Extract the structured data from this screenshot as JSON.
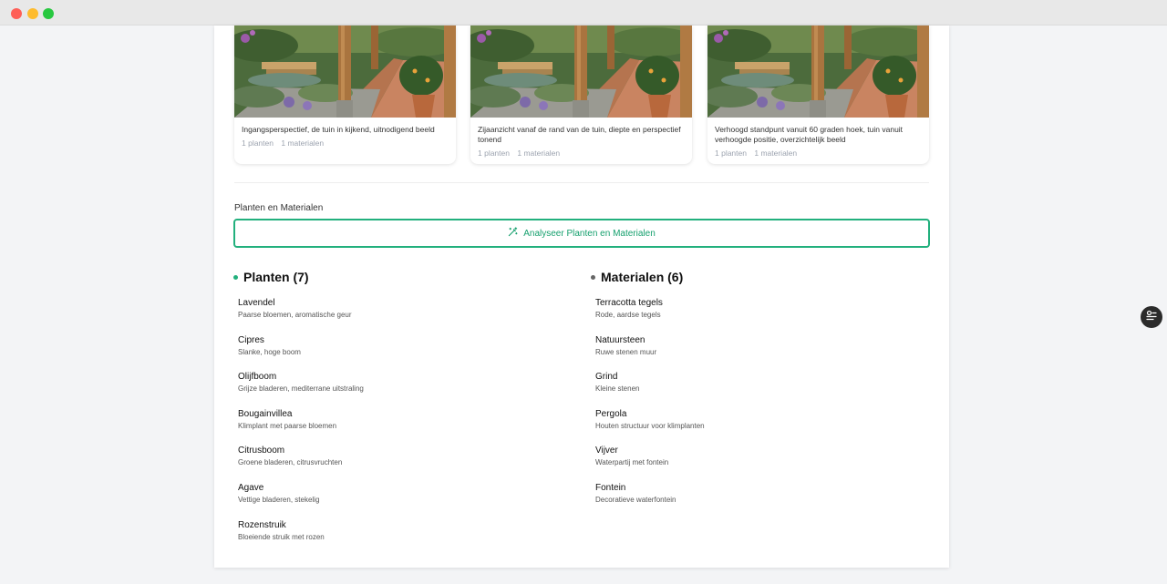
{
  "window": {
    "controls": [
      "close",
      "minimize",
      "maximize"
    ]
  },
  "cards": [
    {
      "title": "Ingangsperspectief, de tuin in kijkend, uitnodigend beeld",
      "plants": "1 planten",
      "materials": "1 materialen"
    },
    {
      "title": "Zijaanzicht vanaf de rand van de tuin, diepte en perspectief tonend",
      "plants": "1 planten",
      "materials": "1 materialen"
    },
    {
      "title": "Verhoogd standpunt vanuit 60 graden hoek, tuin vanuit verhoogde positie, overzichtelijk beeld",
      "plants": "1 planten",
      "materials": "1 materialen"
    }
  ],
  "section": {
    "label": "Planten en Materialen",
    "analyze_button": "Analyseer Planten en Materialen",
    "analyze_icon": "magic-wand-icon"
  },
  "plants": {
    "title": "Planten (7)",
    "items": [
      {
        "name": "Lavendel",
        "desc": "Paarse bloemen, aromatische geur"
      },
      {
        "name": "Cipres",
        "desc": "Slanke, hoge boom"
      },
      {
        "name": "Olijfboom",
        "desc": "Grijze bladeren, mediterrane uitstraling"
      },
      {
        "name": "Bougainvillea",
        "desc": "Klimplant met paarse bloemen"
      },
      {
        "name": "Citrusboom",
        "desc": "Groene bladeren, citrusvruchten"
      },
      {
        "name": "Agave",
        "desc": "Vettige bladeren, stekelig"
      },
      {
        "name": "Rozenstruik",
        "desc": "Bloeiende struik met rozen"
      }
    ]
  },
  "materials": {
    "title": "Materialen (6)",
    "items": [
      {
        "name": "Terracotta tegels",
        "desc": "Rode, aardse tegels"
      },
      {
        "name": "Natuursteen",
        "desc": "Ruwe stenen muur"
      },
      {
        "name": "Grind",
        "desc": "Kleine stenen"
      },
      {
        "name": "Pergola",
        "desc": "Houten structuur voor klimplanten"
      },
      {
        "name": "Vijver",
        "desc": "Waterpartij met fontein"
      },
      {
        "name": "Fontein",
        "desc": "Decoratieve waterfontein"
      }
    ]
  },
  "floating_button": {
    "icon": "list-filter-icon"
  },
  "colors": {
    "accent": "#22b07d",
    "accent_text": "#16a06e",
    "dark": "#2b2b2b"
  }
}
